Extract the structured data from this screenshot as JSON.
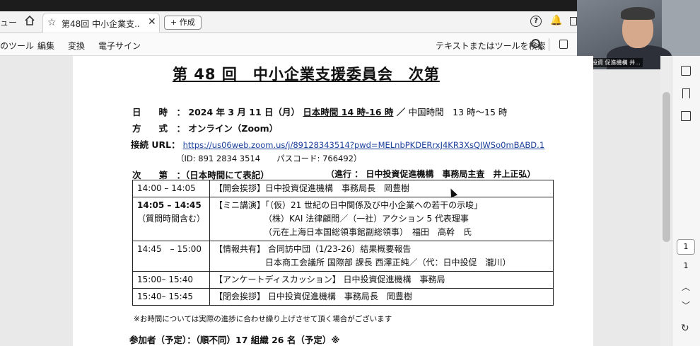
{
  "browser": {
    "prev_tab_label": "ュー",
    "active_tab_title": "第48回 中小企業支...",
    "new_button": "+ 作成"
  },
  "toolbar": {
    "items": [
      "のツール",
      "編集",
      "変換",
      "電子サイン"
    ],
    "search_text": "テキストまたはツールを検索"
  },
  "webcam": {
    "label": "日中投資 促進機構 井..."
  },
  "pager": {
    "current": "1",
    "total": "1"
  },
  "doc": {
    "title": "第 48 回　中小企業支援委員会　次第",
    "date_label": "日　　時　：",
    "date_value": "2024 年 3 月 11 日（月）",
    "date_jp_time": "日本時間 14 時-16 時",
    "date_sep": "／",
    "date_cn_time": "中国時間　13 時〜15 時",
    "method_label": "方　　式　：",
    "method_value": "オンライン（Zoom）",
    "url_label": "接続 URL：",
    "url": "https://us06web.zoom.us/j/89128343514?pwd=MELnbPKDERrxJ4KR3XsQJWSo0mBABD.1",
    "meeting_id": "（ID: 891 2834 3514　　パスコード: 766492）",
    "agenda_label": "次　　第　：（日本時間にて表記）",
    "moderator": "（進行 ： 日中投資促進機構　事務局主査　井上正弘）",
    "schedule": [
      {
        "time": "14:00 – 14:05",
        "lines": [
          "【開会挨拶】日中投資促進機構　事務局長　岡豊樹"
        ]
      },
      {
        "time": "14:05 – 14:45",
        "time_note": "（質問時間含む）",
        "lines": [
          "【ミニ講演】「（仮）21 世紀の日中関係及び中小企業への若干の示唆」",
          "（株）KAI 法律顧問／（一社）アクション 5 代表理事",
          "（元在上海日本国総領事館副総領事）　福田　高幹　氏"
        ]
      },
      {
        "time": "14:45　– 15:00",
        "lines": [
          "【情報共有】 合同訪中団（1/23-26）結果概要報告",
          "日本商工会議所 国際部 課長 西澤正純／（代：日中投促　瀧川）"
        ]
      },
      {
        "time": "15:00– 15:40",
        "lines": [
          "【アンケートディスカッション】 日中投資促進機構　事務局"
        ]
      },
      {
        "time": "15:40– 15:45",
        "lines": [
          "【閉会挨拶】 日中投資促進機構　事務局長　岡豊樹"
        ]
      }
    ],
    "note": "※お時間については実際の進捗に合わせ繰り上げさせて頂く場合がございます",
    "participants": "参加者（予定）：（順不同）17 組織 26 名（予定）※"
  }
}
